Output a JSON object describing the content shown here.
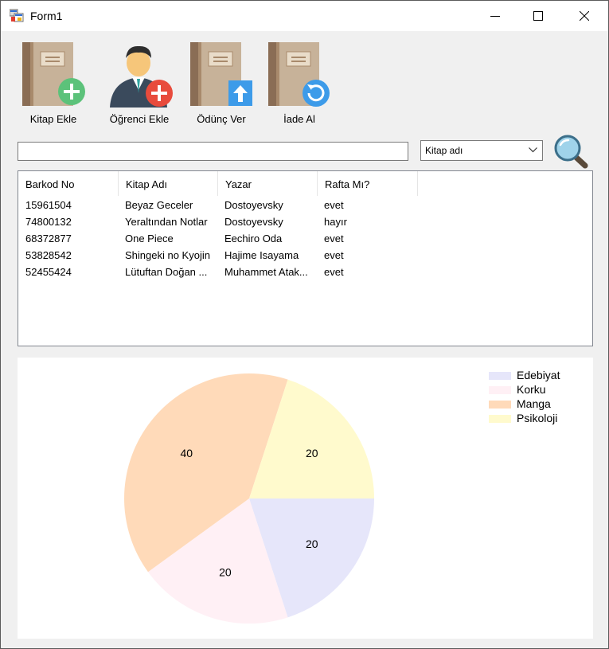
{
  "window": {
    "title": "Form1"
  },
  "toolbar": {
    "kitap_ekle": "Kitap Ekle",
    "ogrenci_ekle": "Öğrenci Ekle",
    "odunc_ver": "Ödünç Ver",
    "iade_al": "İade Al"
  },
  "search": {
    "value": "",
    "filter_selected": "Kitap adı"
  },
  "table": {
    "columns": [
      "Barkod No",
      "Kitap Adı",
      "Yazar",
      "Rafta Mı?"
    ],
    "rows": [
      [
        "15961504",
        "Beyaz Geceler",
        "Dostoyevsky",
        "evet"
      ],
      [
        "74800132",
        "Yeraltından Notlar",
        "Dostoyevsky",
        "hayır"
      ],
      [
        "68372877",
        "One Piece",
        "Eechiro Oda",
        "evet"
      ],
      [
        "53828542",
        "Shingeki no Kyojin",
        "Hajime Isayama",
        "evet"
      ],
      [
        "52455424",
        "Lütuftan Doğan ...",
        "Muhammet Atak...",
        "evet"
      ]
    ]
  },
  "chart_data": {
    "type": "pie",
    "categories": [
      "Edebiyat",
      "Korku",
      "Manga",
      "Psikoloji"
    ],
    "values": [
      20,
      20,
      40,
      20
    ],
    "colors": [
      "#e6e6fa",
      "#fff0f5",
      "#ffdab9",
      "#fffacd"
    ],
    "legend_position": "top-right"
  }
}
